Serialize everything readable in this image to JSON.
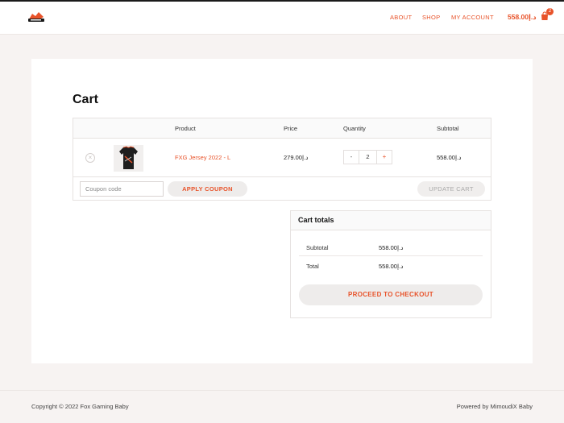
{
  "header": {
    "nav": {
      "about": "ABOUT",
      "shop": "SHOP",
      "account": "MY ACCOUNT"
    },
    "cart": {
      "total": "558.00د.إ",
      "count": "2"
    }
  },
  "page": {
    "title": "Cart"
  },
  "cart_table": {
    "headers": {
      "product": "Product",
      "price": "Price",
      "quantity": "Quantity",
      "subtotal": "Subtotal"
    },
    "items": [
      {
        "name": "FXG Jersey 2022 - L",
        "price": "279.00د.إ",
        "quantity": "2",
        "subtotal": "558.00د.إ",
        "qty_minus": "-",
        "qty_plus": "+",
        "remove": "×"
      }
    ],
    "coupon_placeholder": "Coupon code",
    "apply_coupon": "APPLY COUPON",
    "update_cart": "UPDATE CART"
  },
  "totals": {
    "title": "Cart totals",
    "rows": [
      {
        "label": "Subtotal",
        "value": "558.00د.إ"
      },
      {
        "label": "Total",
        "value": "558.00د.إ"
      }
    ],
    "checkout": "PROCEED TO CHECKOUT"
  },
  "footer": {
    "copyright": "Copyright © 2022 Fox Gaming Baby",
    "powered": "Powered by MimoudiX Baby"
  },
  "colors": {
    "accent": "#e8532a",
    "background": "#f7f3f2",
    "card": "#ffffff"
  },
  "icons": {
    "logo": "fox-gaming-logo",
    "cart": "shopping-bag-icon",
    "remove": "close-circle-icon"
  }
}
